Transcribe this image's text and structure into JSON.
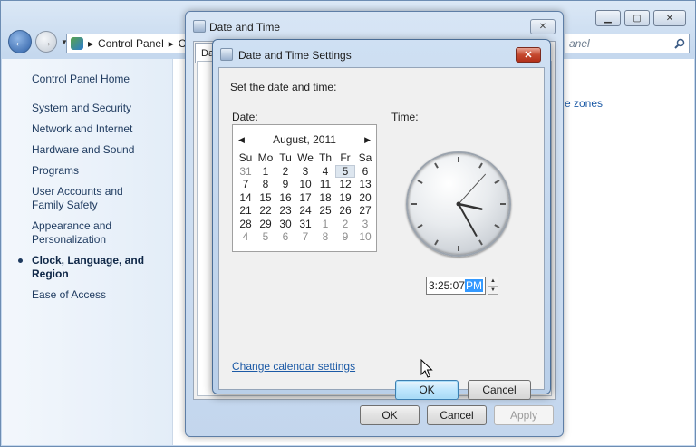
{
  "control_panel": {
    "address_glyph": "▸",
    "address_text": "Control Panel",
    "address_tail": "Cl",
    "address_sep": "▸",
    "search_placeholder": "anel",
    "sidebar": {
      "home": "Control Panel Home",
      "items": [
        {
          "label": "System and Security"
        },
        {
          "label": "Network and Internet"
        },
        {
          "label": "Hardware and Sound"
        },
        {
          "label": "Programs"
        },
        {
          "label": "User Accounts and Family Safety"
        },
        {
          "label": "Appearance and Personalization"
        },
        {
          "label": "Clock, Language, and Region",
          "active": true
        },
        {
          "label": "Ease of Access"
        }
      ]
    },
    "content_link": "e zones"
  },
  "date_time_dialog": {
    "title": "Date and Time",
    "tab_stub": "Da",
    "ok": "OK",
    "cancel": "Cancel",
    "apply": "Apply"
  },
  "settings_dialog": {
    "title": "Date and Time Settings",
    "instruction": "Set the date and time:",
    "date_label": "Date:",
    "time_label": "Time:",
    "calendar": {
      "month_year": "August, 2011",
      "prev": "◀",
      "next": "▶",
      "days_of_week": [
        "Su",
        "Mo",
        "Tu",
        "We",
        "Th",
        "Fr",
        "Sa"
      ],
      "weeks": [
        [
          "31",
          "1",
          "2",
          "3",
          "4",
          "5",
          "6"
        ],
        [
          "7",
          "8",
          "9",
          "10",
          "11",
          "12",
          "13"
        ],
        [
          "14",
          "15",
          "16",
          "17",
          "18",
          "19",
          "20"
        ],
        [
          "21",
          "22",
          "23",
          "24",
          "25",
          "26",
          "27"
        ],
        [
          "28",
          "29",
          "30",
          "31",
          "1",
          "2",
          "3"
        ],
        [
          "4",
          "5",
          "6",
          "7",
          "8",
          "9",
          "10"
        ]
      ],
      "selected_day": "5"
    },
    "time": {
      "hh_mm_ss": "3:25:07",
      "ampm": "PM"
    },
    "change_calendar_link": "Change calendar settings",
    "ok": "OK",
    "cancel": "Cancel"
  }
}
